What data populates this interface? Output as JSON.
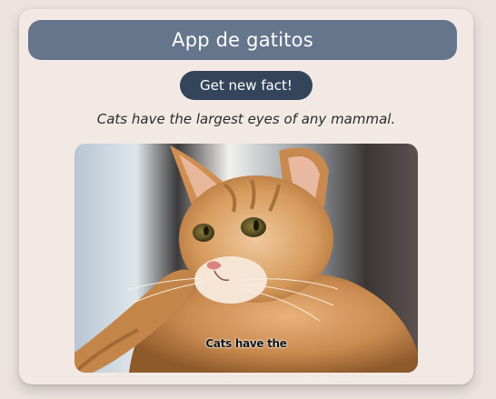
{
  "app": {
    "title": "App de gatitos"
  },
  "controls": {
    "new_fact_label": "Get new fact!"
  },
  "fact": {
    "text": "Cats have the largest eyes of any mammal."
  },
  "image": {
    "caption_overlay": "Cats have the"
  },
  "colors": {
    "header_bg": "#65758c",
    "button_bg": "#34445a",
    "card_bg": "#f3e9e4",
    "page_bg": "#ece3de"
  }
}
